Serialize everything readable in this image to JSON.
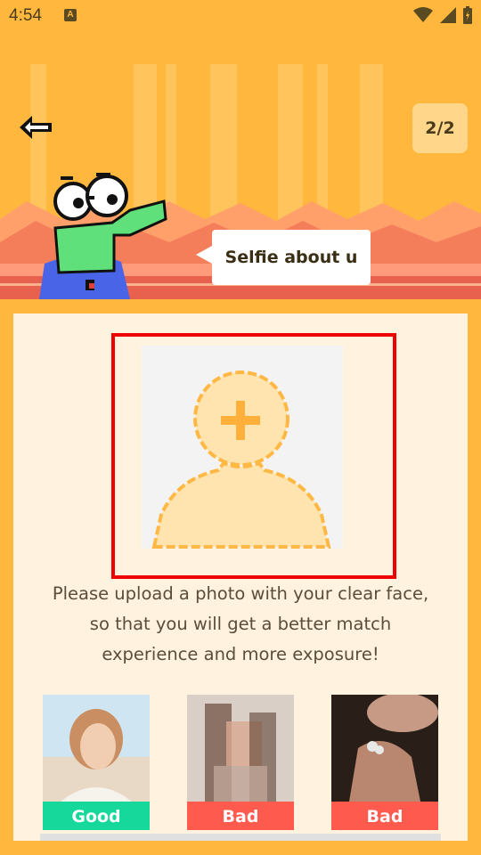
{
  "status_bar": {
    "time": "4:54",
    "notification_letter": "A"
  },
  "header": {
    "progress": "2/2",
    "speech": "Selfie about u"
  },
  "upload": {
    "instruction": "Please upload a photo with your clear face, so that you will get a better match experience and more exposure!"
  },
  "examples": [
    {
      "label": "Good",
      "color": "#15D89A"
    },
    {
      "label": "Bad",
      "color": "#FF5A4E"
    },
    {
      "label": "Bad",
      "color": "#FF5A4E"
    }
  ],
  "colors": {
    "background": "#FFB83D",
    "card": "#FFF3E0",
    "frame": "#EE0000"
  }
}
